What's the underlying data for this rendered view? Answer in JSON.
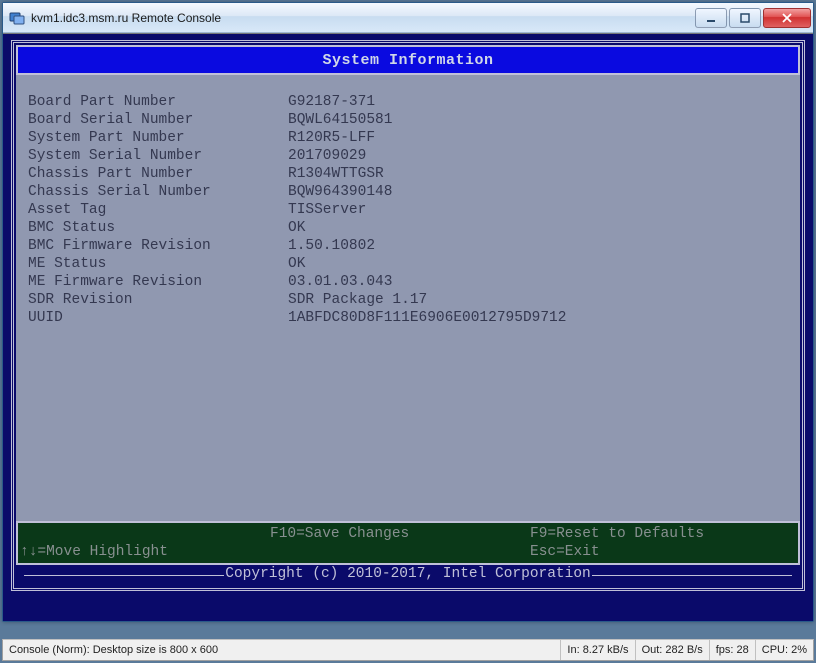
{
  "window": {
    "title": "kvm1.idc3.msm.ru Remote Console"
  },
  "bios": {
    "header": "System Information",
    "rows": [
      {
        "label": "Board Part Number",
        "value": "G92187-371"
      },
      {
        "label": "Board Serial Number",
        "value": "BQWL64150581"
      },
      {
        "label": "System Part Number",
        "value": "R120R5-LFF"
      },
      {
        "label": "System Serial Number",
        "value": "201709029"
      },
      {
        "label": "Chassis Part Number",
        "value": "R1304WTTGSR"
      },
      {
        "label": "Chassis Serial Number",
        "value": "BQW964390148"
      },
      {
        "label": "Asset Tag",
        "value": "TISServer"
      },
      {
        "label": "BMC Status",
        "value": "OK"
      },
      {
        "label": "BMC Firmware Revision",
        "value": "1.50.10802"
      },
      {
        "label": "ME Status",
        "value": "OK"
      },
      {
        "label": "ME Firmware Revision",
        "value": "03.01.03.043"
      },
      {
        "label": "SDR Revision",
        "value": "SDR Package 1.17"
      },
      {
        "label": "UUID",
        "value": "1ABFDC80D8F111E6906E0012795D9712"
      }
    ],
    "footer": {
      "row1": {
        "c1": "",
        "c2": "F10=Save Changes",
        "c3": "F9=Reset to Defaults"
      },
      "row2": {
        "c1": "↑↓=Move Highlight",
        "c2": "",
        "c3": "Esc=Exit"
      }
    },
    "copyright": "Copyright (c) 2010-2017, Intel Corporation"
  },
  "statusbar": {
    "desktop": "Console (Norm): Desktop size is 800 x 600",
    "in": "In: 8.27 kB/s",
    "out": "Out: 282 B/s",
    "fps": "fps: 28",
    "cpu": "CPU: 2%"
  }
}
